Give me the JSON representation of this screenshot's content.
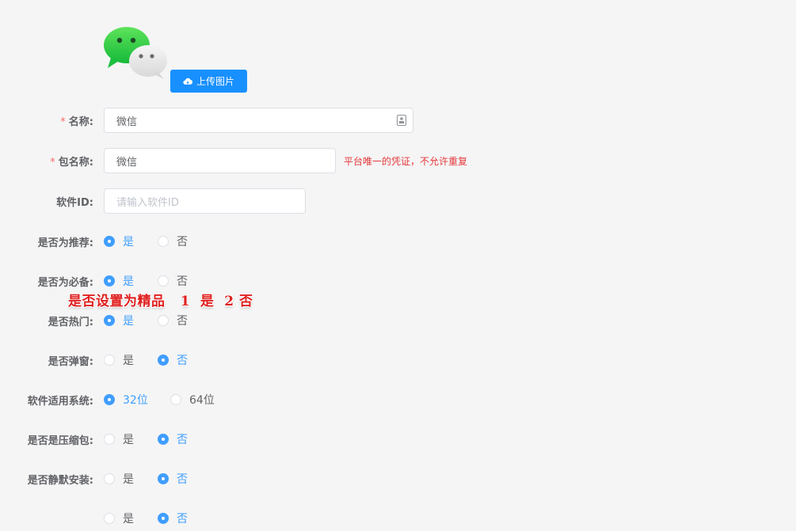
{
  "upload": {
    "label": "上传图片",
    "icon": "cloud-upload-icon"
  },
  "logo": {
    "icon": "wechat-icon"
  },
  "fields": {
    "name": {
      "label": "名称:",
      "value": "微信",
      "required": "*"
    },
    "package": {
      "label": "包名称:",
      "value": "微信",
      "required": "*",
      "hint": "平台唯一的凭证，不允许重复"
    },
    "software_id": {
      "label": "软件ID:",
      "placeholder": "请输入软件ID"
    }
  },
  "radios": [
    {
      "label": "是否为推荐:",
      "options": [
        "是",
        "否"
      ],
      "selected": 0
    },
    {
      "label": "是否为必备:",
      "options": [
        "是",
        "否"
      ],
      "selected": 0
    },
    {
      "label": "是否热门:",
      "options": [
        "是",
        "否"
      ],
      "selected": 0
    },
    {
      "label": "是否弹窗:",
      "options": [
        "是",
        "否"
      ],
      "selected": 1
    },
    {
      "label": "软件适用系统:",
      "options": [
        "32位",
        "64位"
      ],
      "selected": 0
    },
    {
      "label": "是否是压缩包:",
      "options": [
        "是",
        "否"
      ],
      "selected": 1
    },
    {
      "label": "是否静默安装:",
      "options": [
        "是",
        "否"
      ],
      "selected": 1
    },
    {
      "label": "",
      "options": [
        "是",
        "否"
      ],
      "selected": 1
    }
  ],
  "annotation": "是否设置为精品   1  是  2 否",
  "colors": {
    "primary": "#409eff",
    "upload_button": "#1890ff",
    "required": "#f56c6c",
    "hint": "#e4393c"
  }
}
